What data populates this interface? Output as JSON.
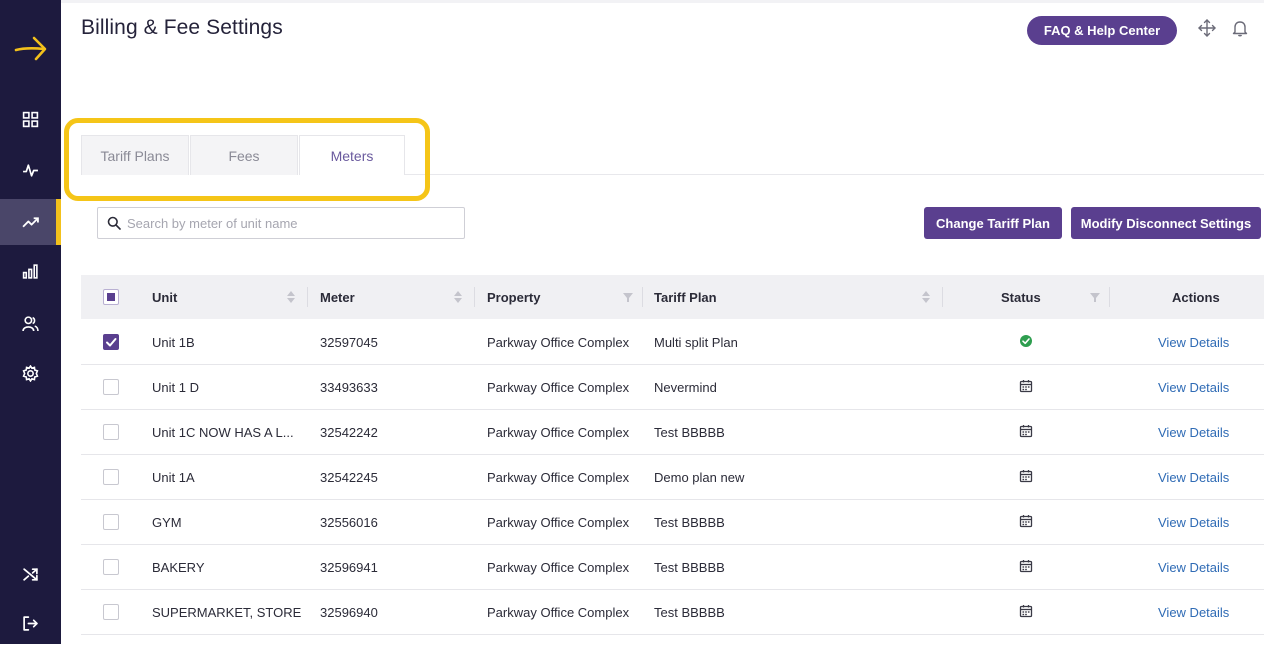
{
  "page": {
    "title": "Billing & Fee Settings"
  },
  "header": {
    "faq_label": "FAQ & Help Center",
    "icons": [
      "move-icon",
      "bell-icon"
    ]
  },
  "sidebar": {
    "items": [
      {
        "icon": "dashboard-grid-icon",
        "active": false
      },
      {
        "icon": "activity-pulse-icon",
        "active": false
      },
      {
        "icon": "trending-up-icon",
        "active": true
      },
      {
        "icon": "bar-chart-icon",
        "active": false
      },
      {
        "icon": "users-icon",
        "active": false
      },
      {
        "icon": "settings-gear-icon",
        "active": false
      },
      {
        "icon": "shuffle-icon",
        "active": false
      },
      {
        "icon": "logout-icon",
        "active": false
      }
    ]
  },
  "tabs": [
    {
      "label": "Tariff Plans",
      "active": false
    },
    {
      "label": "Fees",
      "active": false
    },
    {
      "label": "Meters",
      "active": true
    }
  ],
  "search": {
    "placeholder": "Search by meter of unit name",
    "value": ""
  },
  "toolbar": {
    "change_tariff_label": "Change Tariff Plan",
    "modify_disconnect_label": "Modify Disconnect Settings"
  },
  "table": {
    "columns": [
      "Unit",
      "Meter",
      "Property",
      "Tariff Plan",
      "Status",
      "Actions"
    ],
    "rows": [
      {
        "checked": true,
        "unit": "Unit 1B",
        "meter": "32597045",
        "property": "Parkway Office Complex",
        "tariff": "Multi split Plan",
        "status": "active",
        "action": "View Details"
      },
      {
        "checked": false,
        "unit": "Unit 1 D",
        "meter": "33493633",
        "property": "Parkway Office Complex",
        "tariff": "Nevermind",
        "status": "scheduled",
        "action": "View Details"
      },
      {
        "checked": false,
        "unit": "Unit 1C NOW HAS A L...",
        "meter": "32542242",
        "property": "Parkway Office Complex",
        "tariff": "Test BBBBB",
        "status": "scheduled",
        "action": "View Details"
      },
      {
        "checked": false,
        "unit": "Unit 1A",
        "meter": "32542245",
        "property": "Parkway Office Complex",
        "tariff": "Demo plan new",
        "status": "scheduled",
        "action": "View Details"
      },
      {
        "checked": false,
        "unit": "GYM",
        "meter": "32556016",
        "property": "Parkway Office Complex",
        "tariff": "Test BBBBB",
        "status": "scheduled",
        "action": "View Details"
      },
      {
        "checked": false,
        "unit": "BAKERY",
        "meter": "32596941",
        "property": "Parkway Office Complex",
        "tariff": "Test BBBBB",
        "status": "scheduled",
        "action": "View Details"
      },
      {
        "checked": false,
        "unit": "SUPERMARKET, STORE",
        "meter": "32596940",
        "property": "Parkway Office Complex",
        "tariff": "Test BBBBB",
        "status": "scheduled",
        "action": "View Details"
      }
    ]
  },
  "colors": {
    "brand": "#5a3f8f",
    "sidebar": "#1d1a3e",
    "highlight": "#f5c518",
    "accent": "#f3c11b",
    "link": "#2f6bb5",
    "status_ok": "#2e9e4f"
  }
}
